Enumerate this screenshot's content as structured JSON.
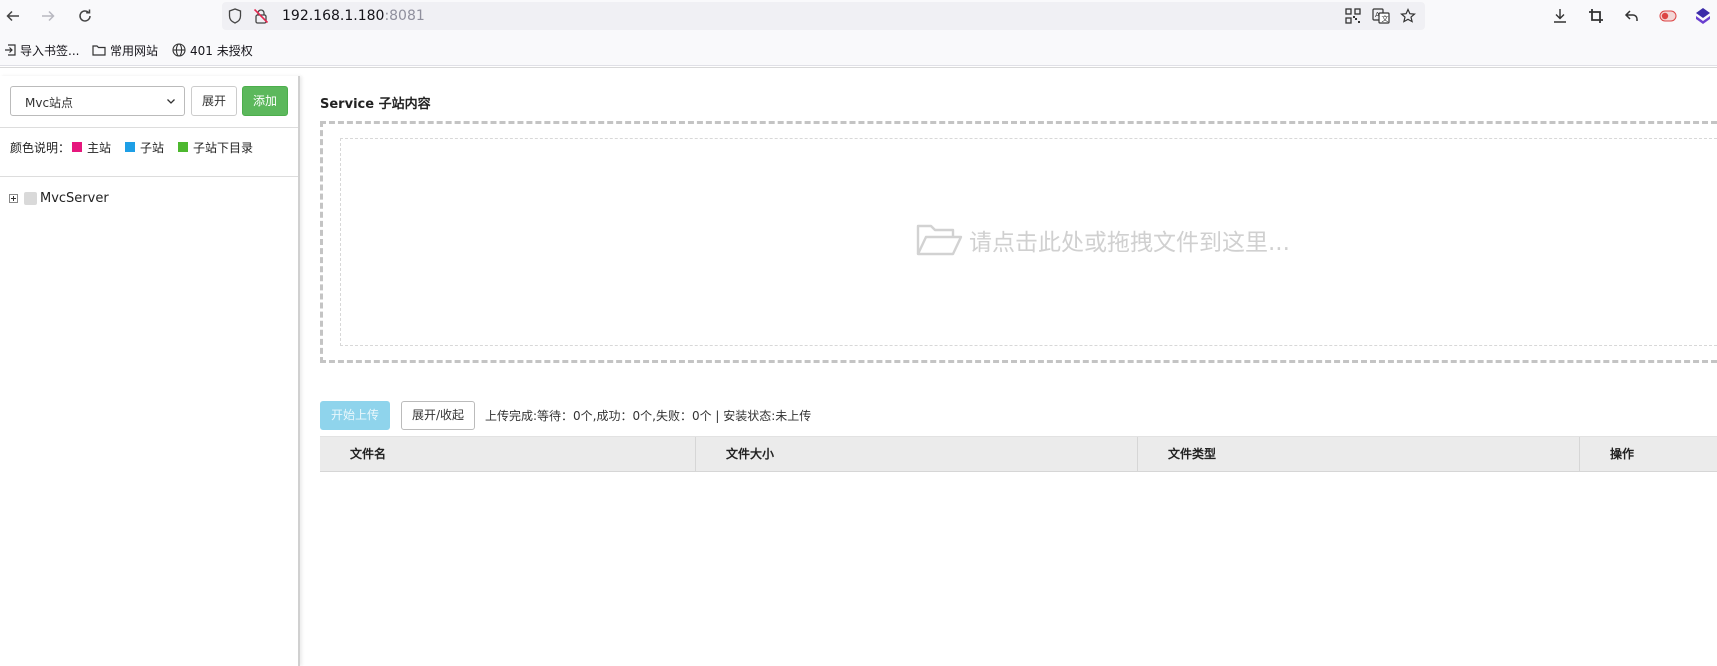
{
  "browser": {
    "url_host": "192.168.1.180",
    "url_port": ":8081",
    "icons": [
      "back-icon",
      "forward-icon",
      "reload-icon",
      "shield-icon",
      "insecure-lock-icon",
      "qr-code-icon",
      "translate-icon",
      "star-icon",
      "download-icon",
      "crop-icon",
      "undo-icon",
      "toggle-icon",
      "extension-icon"
    ]
  },
  "bookmarks": [
    {
      "label": "导入书签..."
    },
    {
      "label": "常用网站"
    },
    {
      "label": "401 未授权"
    }
  ],
  "sidebar": {
    "select_value": "Mvc站点",
    "expand_label": "展开",
    "add_label": "添加",
    "legend_prefix": "颜色说明：",
    "legend": [
      {
        "label": "主站",
        "color": "#e6177d"
      },
      {
        "label": "子站",
        "color": "#1e9fe6"
      },
      {
        "label": "子站下目录",
        "color": "#4db82f"
      }
    ],
    "tree_root": "MvcServer"
  },
  "main": {
    "title": "Service 子站内容",
    "drop_hint": "请点击此处或拖拽文件到这里...",
    "start_upload_label": "开始上传",
    "toggle_label": "展开/收起",
    "status": "上传完成:等待：0个,成功：0个,失败：0个 | 安装状态:未上传",
    "table_headers": [
      "文件名",
      "文件大小",
      "文件类型",
      "操作"
    ]
  },
  "colors": {
    "add_button": "#5cb85c",
    "start_button": "#8fd4ec"
  }
}
